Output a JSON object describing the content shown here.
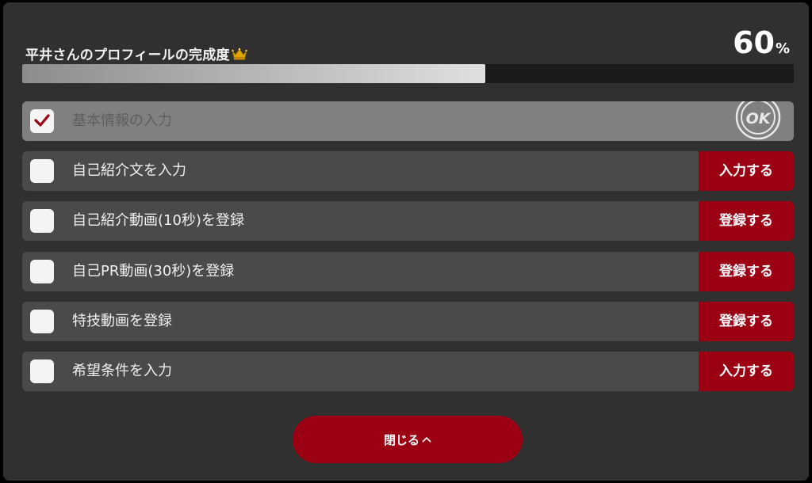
{
  "profile": {
    "title": "平井さんのプロフィールの完成度",
    "title_icon": "crown-icon",
    "progress_value": "60",
    "progress_unit": "%",
    "progress_fraction": 0.6
  },
  "tasks": [
    {
      "label": "基本情報の入力",
      "done": true,
      "badge": "OK"
    },
    {
      "label": "自己紹介文を入力",
      "done": false,
      "action": "入力する"
    },
    {
      "label": "自己紹介動画(10秒)を登録",
      "done": false,
      "action": "登録する"
    },
    {
      "label": "自己PR動画(30秒)を登録",
      "done": false,
      "action": "登録する"
    },
    {
      "label": "特技動画を登録",
      "done": false,
      "action": "登録する"
    },
    {
      "label": "希望条件を入力",
      "done": false,
      "action": "入力する"
    }
  ],
  "close_button": {
    "label": "閉じる",
    "icon": "chevron-up-icon"
  },
  "colors": {
    "panel": "#303030",
    "task_bg": "#4a4a4a",
    "task_done_bg": "#808080",
    "accent_red": "#9c0013",
    "crown_gold": "#e2a500",
    "check_red": "#9c0013"
  }
}
